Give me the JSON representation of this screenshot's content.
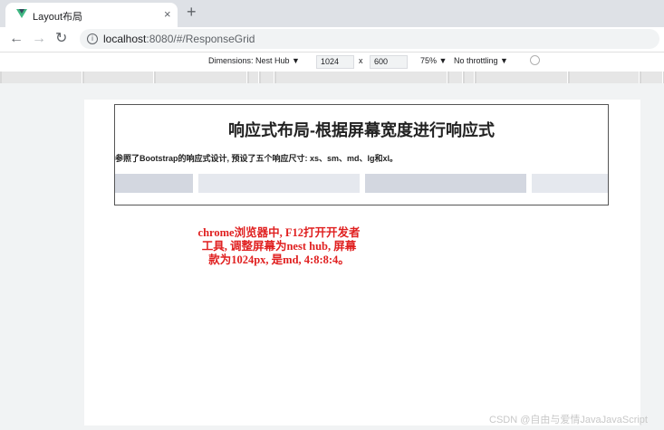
{
  "tab": {
    "title": "Layout布局",
    "close": "×",
    "new_tab": "+"
  },
  "nav": {
    "back": "←",
    "forward": "→",
    "reload": "↻",
    "info": "i",
    "url_host": "localhost",
    "url_path": ":8080/#/ResponseGrid"
  },
  "device_toolbar": {
    "dimensions_label": "Dimensions: Nest Hub ▼",
    "width": "1024",
    "times": "x",
    "height": "600",
    "zoom": "75% ▼",
    "throttling": "No throttling ▼"
  },
  "page": {
    "heading": "响应式布局-根据屏幕宽度进行响应式",
    "intro": "参照了Bootstrap的响应式设计, 预设了五个响应尺寸: xs、sm、md、lg和xl。",
    "columns": [
      {
        "span": 4
      },
      {
        "span": 8
      },
      {
        "span": 8
      },
      {
        "span": 4
      }
    ]
  },
  "annotation": {
    "line1": "chrome浏览器中, F12打开开发者",
    "line2": "工具, 调整屏幕为nest hub, 屏幕",
    "line3": "款为1024px, 是md, 4:8:8:4。"
  },
  "watermark": "CSDN @自由与爱情JavaJavaScript",
  "colors": {
    "annotation": "#e02020",
    "column_dark": "#d3d7e0",
    "column_light": "#e5e8ee",
    "vue_green": "#41b883"
  }
}
